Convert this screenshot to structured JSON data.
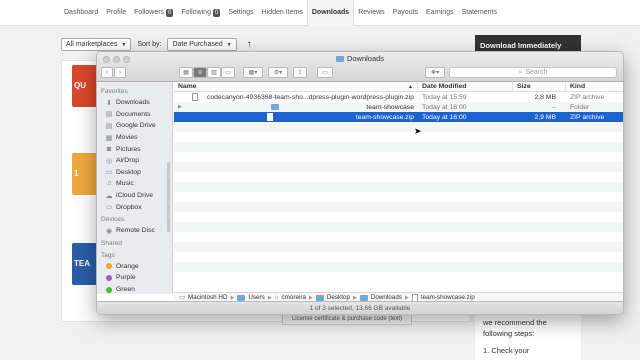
{
  "topnav": {
    "items": [
      {
        "label": "Dashboard"
      },
      {
        "label": "Profile"
      },
      {
        "label": "Followers",
        "badge": "0"
      },
      {
        "label": "Following",
        "badge": "0"
      },
      {
        "label": "Settings"
      },
      {
        "label": "Hidden Items"
      },
      {
        "label": "Downloads",
        "active": true
      },
      {
        "label": "Reviews"
      },
      {
        "label": "Payouts"
      },
      {
        "label": "Earnings"
      },
      {
        "label": "Statements"
      }
    ]
  },
  "filters": {
    "marketplace": "All marketplaces",
    "sort_label": "Sort by:",
    "sort_value": "Date Purchased"
  },
  "download_panel": {
    "title": "Download Immediately",
    "text_line1": "we recommend the",
    "text_line2": "following steps:",
    "step1": "1. Check your"
  },
  "items": {
    "thumb1_text": "QU",
    "thumb2_text": "1",
    "thumb3_text": "TEA",
    "license_button": "License certificate & purchase code (text)"
  },
  "finder": {
    "title": "Downloads",
    "search_placeholder": "Search",
    "sidebar": {
      "favorites_heading": "Favorites",
      "favorites": [
        {
          "label": "Downloads",
          "icon": "download-icon"
        },
        {
          "label": "Documents",
          "icon": "document-icon"
        },
        {
          "label": "Google Drive",
          "icon": "drive-icon"
        },
        {
          "label": "Movies",
          "icon": "film-icon"
        },
        {
          "label": "Pictures",
          "icon": "camera-icon"
        },
        {
          "label": "AirDrop",
          "icon": "airdrop-icon"
        },
        {
          "label": "Desktop",
          "icon": "desktop-icon"
        },
        {
          "label": "Music",
          "icon": "music-icon"
        },
        {
          "label": "iCloud Drive",
          "icon": "cloud-icon"
        },
        {
          "label": "Dropbox",
          "icon": "folder-icon"
        }
      ],
      "devices_heading": "Devices",
      "devices": [
        {
          "label": "Remote Disc",
          "icon": "disc-icon"
        }
      ],
      "shared_heading": "Shared",
      "tags_heading": "Tags",
      "tags": [
        {
          "label": "Orange",
          "color": "#f5a623"
        },
        {
          "label": "Purple",
          "color": "#a15ed1"
        },
        {
          "label": "Green",
          "color": "#4cbc3a"
        }
      ]
    },
    "columns": {
      "name": "Name",
      "date": "Date Modified",
      "size": "Size",
      "kind": "Kind"
    },
    "files": [
      {
        "name": "codecanyon-4936368-team-sho...dpress-plugin-wordpress-plugin.zip",
        "date": "Today at 15:59",
        "size": "2,8 MB",
        "kind": "ZIP archive",
        "type": "file"
      },
      {
        "name": "team-showcase",
        "date": "Today at 16:00",
        "size": "--",
        "kind": "Folder",
        "type": "folder"
      },
      {
        "name": "team-showcase.zip",
        "date": "Today at 16:00",
        "size": "2,9 MB",
        "kind": "ZIP archive",
        "type": "file",
        "selected": true
      }
    ],
    "path": [
      "Macintosh HD",
      "Users",
      "cmoreira",
      "Desktop",
      "Downloads",
      "team-showcase.zip"
    ],
    "status": "1 of 3 selected, 13,66 GB available"
  }
}
